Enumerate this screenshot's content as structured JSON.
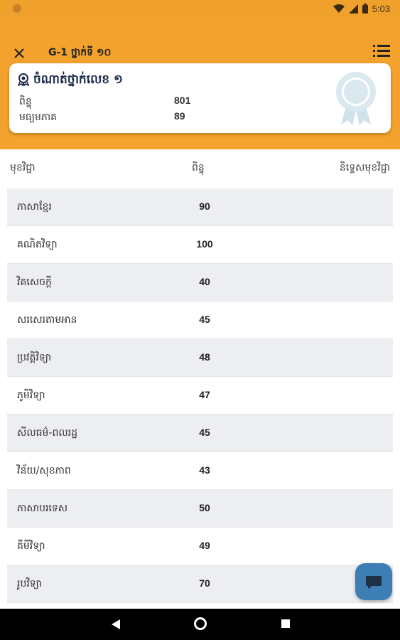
{
  "status_bar": {
    "time": "5:03"
  },
  "app_bar": {
    "title": "G-1   ថ្នាក់ទី ១០"
  },
  "summary_card": {
    "title": "ចំណាត់ថ្នាក់លេខ ១",
    "rows": [
      {
        "label": "ពិន្ទុ",
        "value": "801"
      },
      {
        "label": "មធ្យមភាគ",
        "value": "89"
      }
    ]
  },
  "table": {
    "headers": [
      "មុខវិជ្ជា",
      "ពិន្ទុ",
      "និទ្ទេសមុខវិជ្ជា"
    ],
    "rows": [
      {
        "subject": "ភាសាខ្មែរ",
        "score": "90"
      },
      {
        "subject": "គណិតវិទ្យា",
        "score": "100"
      },
      {
        "subject": "វិគសេចក្តី",
        "score": "40"
      },
      {
        "subject": "សរសេរតាមអាន",
        "score": "45"
      },
      {
        "subject": "ប្រវត្តិវិទ្យា",
        "score": "48"
      },
      {
        "subject": "ភូមិវិទ្យា",
        "score": "47"
      },
      {
        "subject": "សីលធម៌-ពលរដ្ឋ",
        "score": "45"
      },
      {
        "subject": "វិន័យ/សុខភាព",
        "score": "43"
      },
      {
        "subject": "ភាសាបរទេស",
        "score": "50"
      },
      {
        "subject": "គីមីវិទ្យា",
        "score": "49"
      },
      {
        "subject": "រូបវិទ្យា",
        "score": "70"
      }
    ]
  },
  "colors": {
    "accent": "#f2a22d",
    "fab": "#3d7fb5",
    "title": "#1b2a4a"
  }
}
